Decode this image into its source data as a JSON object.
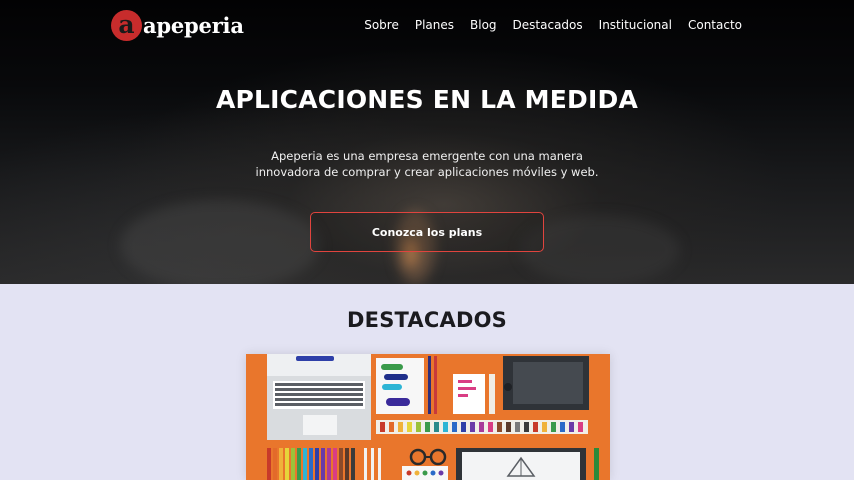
{
  "brand": {
    "logo_letter": "a",
    "name": "apeperia",
    "accent": "#c72c2c"
  },
  "nav": {
    "items": [
      {
        "label": "Sobre"
      },
      {
        "label": "Planes"
      },
      {
        "label": "Blog"
      },
      {
        "label": "Destacados"
      },
      {
        "label": "Institucional"
      },
      {
        "label": "Contacto"
      }
    ]
  },
  "hero": {
    "title": "APLICACIONES EN LA MEDIDA",
    "description": "Apeperia es una empresa emergente con una manera innovadora de comprar y crear aplicaciones móviles y web.",
    "cta_label": "Conozca los plans",
    "cta_border_color": "#e0443e"
  },
  "featured": {
    "title": "DESTACADOS",
    "image_background": "#e9762c"
  }
}
